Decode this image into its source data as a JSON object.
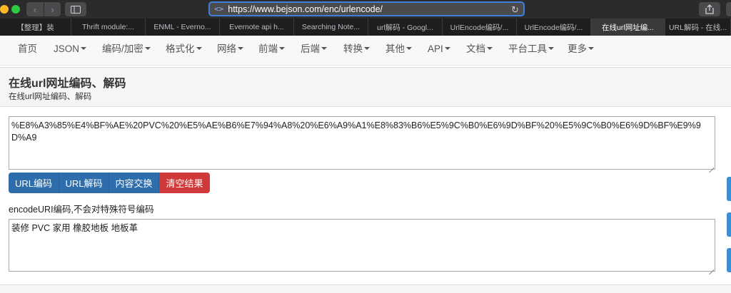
{
  "browser": {
    "url": "https://www.bejson.com/enc/urlencode/",
    "tabs": [
      {
        "label": "【整理】装",
        "active": false
      },
      {
        "label": "Thrift module:...",
        "active": false
      },
      {
        "label": "ENML - Everno...",
        "active": false
      },
      {
        "label": "Evernote api h...",
        "active": false
      },
      {
        "label": "Searching Note...",
        "active": false
      },
      {
        "label": "url解码 - Googl...",
        "active": false
      },
      {
        "label": "UrlEncode编码/...",
        "active": false
      },
      {
        "label": "UrlEncode编码/...",
        "active": false
      },
      {
        "label": "在线url网址编...",
        "active": true
      },
      {
        "label": "URL解码 - 在线...",
        "active": false
      }
    ]
  },
  "sitenav": {
    "items": [
      {
        "label": "首页",
        "dropdown": false
      },
      {
        "label": "JSON",
        "dropdown": true
      },
      {
        "label": "编码/加密",
        "dropdown": true
      },
      {
        "label": "格式化",
        "dropdown": true
      },
      {
        "label": "网络",
        "dropdown": true
      },
      {
        "label": "前端",
        "dropdown": true
      },
      {
        "label": "后端",
        "dropdown": true
      },
      {
        "label": "转换",
        "dropdown": true
      },
      {
        "label": "其他",
        "dropdown": true
      },
      {
        "label": "API",
        "dropdown": true
      },
      {
        "label": "文档",
        "dropdown": true
      },
      {
        "label": "平台工具",
        "dropdown": true
      },
      {
        "label": "更多",
        "dropdown": true
      }
    ]
  },
  "panel": {
    "title": "在线url网址编码、解码",
    "subtitle": "在线url网址编码、解码"
  },
  "input": {
    "value": "%E8%A3%85%E4%BF%AE%20PVC%20%E5%AE%B6%E7%94%A8%20%E6%A9%A1%E8%83%B6%E5%9C%B0%E6%9D%BF%20%E5%9C%B0%E6%9D%BF%E9%9D%A9"
  },
  "buttons": {
    "encode": "URL编码",
    "decode": "URL解码",
    "swap": "内容交换",
    "clear": "清空结果"
  },
  "note": "encodeURI编码,不会对特殊符号编码",
  "output": {
    "value": "装修 PVC 家用 橡胶地板 地板革"
  },
  "colors": {
    "primary": "#2e6dac",
    "danger": "#d0393a",
    "address_focus": "#3d7fd9"
  }
}
